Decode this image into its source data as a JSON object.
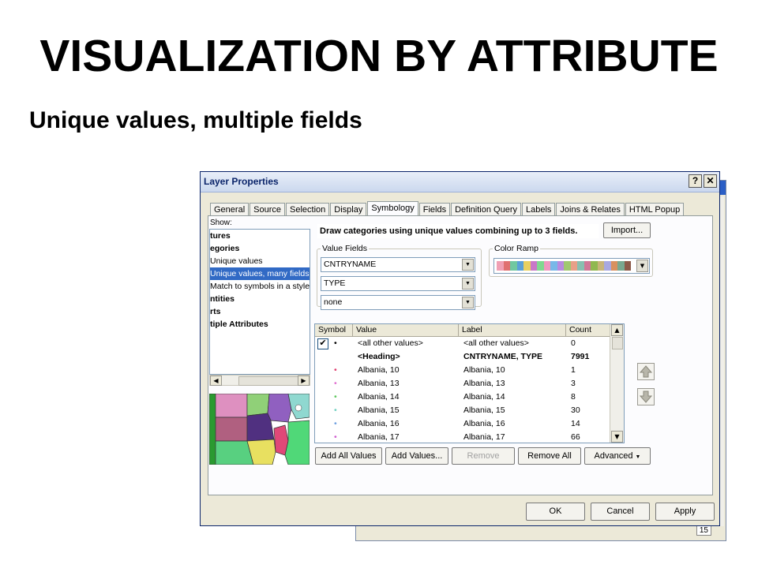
{
  "slide": {
    "title": "VISUALIZATION  BY ATTRIBUTE",
    "subtitle": "Unique values, multiple fields"
  },
  "dialog": {
    "title": "Layer Properties",
    "help_label": "?",
    "close_label": "✕",
    "tabs": [
      "General",
      "Source",
      "Selection",
      "Display",
      "Symbology",
      "Fields",
      "Definition Query",
      "Labels",
      "Joins & Relates",
      "HTML Popup"
    ],
    "active_tab": "Symbology",
    "back_window_page": "15"
  },
  "show": {
    "label": "Show:",
    "items": [
      {
        "label": "tures",
        "bold": true
      },
      {
        "label": "egories",
        "bold": true
      },
      {
        "label": "Unique values",
        "bold": false
      },
      {
        "label": "Unique values, many fields",
        "bold": false,
        "selected": true
      },
      {
        "label": "Match to symbols in a style",
        "bold": false
      },
      {
        "label": "ntities",
        "bold": true
      },
      {
        "label": "rts",
        "bold": true
      },
      {
        "label": "tiple Attributes",
        "bold": true
      }
    ]
  },
  "symbology": {
    "description": "Draw categories using unique values combining up to 3 fields.",
    "import_label": "Import...",
    "value_fields_legend": "Value Fields",
    "fields": [
      "CNTRYNAME",
      "TYPE",
      "none"
    ],
    "color_ramp_legend": "Color Ramp",
    "color_ramp": [
      "#f0a0b4",
      "#e07070",
      "#70c8a0",
      "#5aa0d8",
      "#e8d060",
      "#c878c8",
      "#80d890",
      "#f098c0",
      "#78b8e8",
      "#b88ae0",
      "#a0c870",
      "#e8a088",
      "#88c0b0",
      "#d07898",
      "#90b850",
      "#c8b478",
      "#a8a8e0",
      "#d89060",
      "#78a890",
      "#8c5a4a"
    ]
  },
  "table": {
    "columns": [
      "Symbol",
      "Value",
      "Label",
      "Count"
    ],
    "rows": [
      {
        "symbol": "•",
        "value": "<all other values>",
        "label": "<all other values>",
        "count": "0",
        "checked": true,
        "bold": false,
        "color": "#000000"
      },
      {
        "symbol": "",
        "value": "<Heading>",
        "label": "CNTRYNAME, TYPE",
        "count": "7991",
        "checked": false,
        "bold": true,
        "color": "#000000"
      },
      {
        "symbol": "•",
        "value": "Albania, 10",
        "label": "Albania, 10",
        "count": "1",
        "checked": false,
        "bold": false,
        "color": "#e04070"
      },
      {
        "symbol": "•",
        "value": "Albania, 13",
        "label": "Albania, 13",
        "count": "3",
        "checked": false,
        "bold": false,
        "color": "#e070d0"
      },
      {
        "symbol": "•",
        "value": "Albania, 14",
        "label": "Albania, 14",
        "count": "8",
        "checked": false,
        "bold": false,
        "color": "#60c860"
      },
      {
        "symbol": "•",
        "value": "Albania, 15",
        "label": "Albania, 15",
        "count": "30",
        "checked": false,
        "bold": false,
        "color": "#70d0c0"
      },
      {
        "symbol": "•",
        "value": "Albania, 16",
        "label": "Albania, 16",
        "count": "14",
        "checked": false,
        "bold": false,
        "color": "#70a0e0"
      },
      {
        "symbol": "•",
        "value": "Albania, 17",
        "label": "Albania, 17",
        "count": "66",
        "checked": false,
        "bold": false,
        "color": "#d060d0"
      }
    ]
  },
  "buttons": {
    "add_all_values": "Add All Values",
    "add_values": "Add Values...",
    "remove": "Remove",
    "remove_all": "Remove All",
    "advanced": "Advanced",
    "ok": "OK",
    "cancel": "Cancel",
    "apply": "Apply"
  }
}
